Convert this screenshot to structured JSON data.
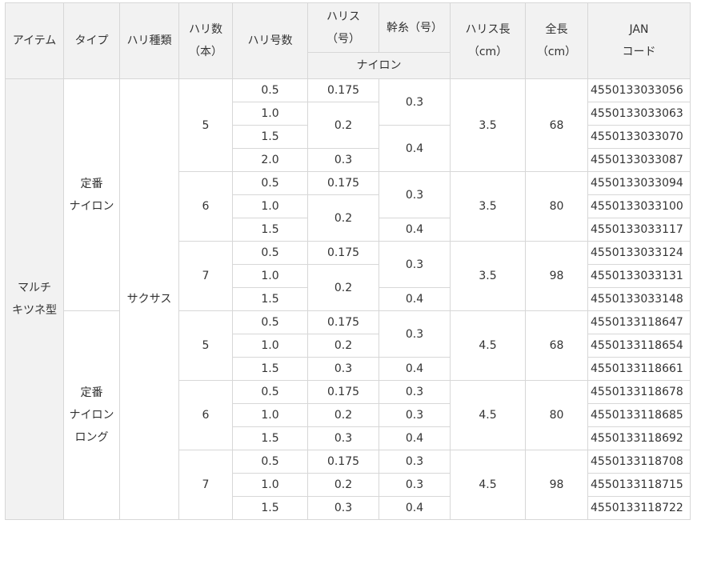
{
  "header": {
    "item": "アイテム",
    "type": "タイプ",
    "hook_kind": "ハリ種類",
    "hook_count": [
      "ハリ数",
      "（本）"
    ],
    "hook_size": "ハリ号数",
    "harisu": [
      "ハリス",
      "（号）"
    ],
    "mikiito": "幹糸（号）",
    "harisu_len": [
      "ハリス長",
      "（cm）"
    ],
    "total_len": [
      "全長",
      "（cm）"
    ],
    "jan": [
      "JAN",
      "コード"
    ],
    "nylon": "ナイロン"
  },
  "item": [
    "マルチ",
    "キツネ型"
  ],
  "hook_kind": "サクサス",
  "types": [
    [
      "定番",
      "ナイロン"
    ],
    [
      "定番",
      "ナイロン",
      "ロング"
    ]
  ],
  "groups": [
    {
      "count": "5",
      "harisu_len": "3.5",
      "total_len": "68",
      "sizes": [
        "0.5",
        "1.0",
        "1.5",
        "2.0"
      ],
      "harisu": [
        "0.175",
        "0.2",
        "0.3"
      ],
      "mikiito": [
        "0.3",
        "0.4"
      ],
      "jan": [
        "4550133033056",
        "4550133033063",
        "4550133033070",
        "4550133033087"
      ]
    },
    {
      "count": "6",
      "harisu_len": "3.5",
      "total_len": "80",
      "sizes": [
        "0.5",
        "1.0",
        "1.5"
      ],
      "harisu": [
        "0.175",
        "0.2"
      ],
      "mikiito": [
        "0.3",
        "0.4"
      ],
      "jan": [
        "4550133033094",
        "4550133033100",
        "4550133033117"
      ]
    },
    {
      "count": "7",
      "harisu_len": "3.5",
      "total_len": "98",
      "sizes": [
        "0.5",
        "1.0",
        "1.5"
      ],
      "harisu": [
        "0.175",
        "0.2"
      ],
      "mikiito": [
        "0.3",
        "0.4"
      ],
      "jan": [
        "4550133033124",
        "4550133033131",
        "4550133033148"
      ]
    },
    {
      "count": "5",
      "harisu_len": "4.5",
      "total_len": "68",
      "sizes": [
        "0.5",
        "1.0",
        "1.5"
      ],
      "harisu": [
        "0.175",
        "0.2",
        "0.3"
      ],
      "mikiito": [
        "0.3",
        "0.4"
      ],
      "jan": [
        "4550133118647",
        "4550133118654",
        "4550133118661"
      ]
    },
    {
      "count": "6",
      "harisu_len": "4.5",
      "total_len": "80",
      "sizes": [
        "0.5",
        "1.0",
        "1.5"
      ],
      "harisu": [
        "0.175",
        "0.2",
        "0.3"
      ],
      "mikiito": [
        "0.3",
        "0.3",
        "0.4"
      ],
      "jan": [
        "4550133118678",
        "4550133118685",
        "4550133118692"
      ]
    },
    {
      "count": "7",
      "harisu_len": "4.5",
      "total_len": "98",
      "sizes": [
        "0.5",
        "1.0",
        "1.5"
      ],
      "harisu": [
        "0.175",
        "0.2",
        "0.3"
      ],
      "mikiito": [
        "0.3",
        "0.3",
        "0.4"
      ],
      "jan": [
        "4550133118708",
        "4550133118715",
        "4550133118722"
      ]
    }
  ]
}
